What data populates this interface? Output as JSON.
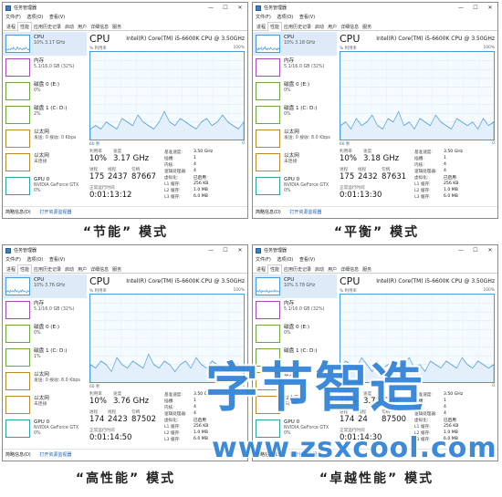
{
  "window": {
    "title": "任务管理器",
    "min": "—",
    "max": "☐",
    "close": "✕"
  },
  "menu": [
    "文件(F)",
    "选项(O)",
    "查看(V)"
  ],
  "tabs": [
    "进程",
    "性能",
    "应用历史记录",
    "启动",
    "用户",
    "详细信息",
    "服务"
  ],
  "sidebar": [
    {
      "name": "CPU",
      "sub": "",
      "kind": "cpu"
    },
    {
      "name": "内存",
      "sub": "5.1/16.0 GB (32%)",
      "kind": "mem"
    },
    {
      "name": "磁盘 0 (E:)",
      "sub": "0%",
      "kind": "disk"
    },
    {
      "name": "磁盘 1 (C: D:)",
      "sub": "",
      "kind": "disk"
    },
    {
      "name": "以太网",
      "sub": "",
      "kind": "net"
    },
    {
      "name": "以太网",
      "sub": "未连接",
      "kind": "net"
    },
    {
      "name": "GPU 0",
      "sub": "NVIDIA GeForce GTX",
      "sub2": "0%",
      "kind": "gpu"
    }
  ],
  "main": {
    "cpu_title": "CPU",
    "cpu_model": "Intel(R) Core(TM) i5-6600K CPU @ 3.50GHz",
    "util_label": "% 利用率",
    "util_max": "100%",
    "graph_left": "60 秒",
    "graph_right": "0",
    "labels": {
      "util": "利用率",
      "speed": "速度",
      "proc": "进程",
      "threads": "线程",
      "handles": "句柄",
      "uptime": "正常运行时间"
    },
    "spec_keys": [
      "基准速度:",
      "插槽:",
      "内核:",
      "逻辑处理器:",
      "虚拟化:",
      "L1 缓存:",
      "L2 缓存:",
      "L3 缓存:"
    ],
    "spec_vals": [
      "3.50 GHz",
      "1",
      "4",
      "4",
      "已启用",
      "256 KB",
      "1.0 MB",
      "6.0 MB"
    ]
  },
  "footer": {
    "brief": "简略信息(D)",
    "monitor": "打开资源监视器"
  },
  "panels": [
    {
      "cpu_sub": "10%  3.17 GHz",
      "disk1_sub": "2%",
      "net_sub": "发送: 0 接收: 0 Kbps",
      "util": "10%",
      "speed": "3.17 GHz",
      "proc": "175",
      "threads": "2437",
      "handles": "87667",
      "uptime": "0:01:13:12",
      "graph": [
        3,
        4,
        3,
        5,
        4,
        3,
        6,
        5,
        4,
        7,
        5,
        4,
        3,
        5,
        8,
        5,
        4,
        6,
        5,
        4,
        3,
        5,
        6,
        4,
        5,
        7,
        5,
        4,
        3,
        5
      ],
      "caption": "“节能”  模式"
    },
    {
      "cpu_sub": "10%  3.18 GHz",
      "disk1_sub": "0%",
      "net_sub": "发送: 0 接收: 8.0 Kbps",
      "util": "10%",
      "speed": "3.18 GHz",
      "proc": "175",
      "threads": "2432",
      "handles": "87631",
      "uptime": "0:01:13:30",
      "graph": [
        4,
        5,
        3,
        6,
        4,
        5,
        7,
        4,
        3,
        6,
        5,
        8,
        4,
        5,
        3,
        6,
        5,
        4,
        7,
        5,
        4,
        3,
        6,
        5,
        4,
        5,
        3,
        6,
        4,
        5
      ],
      "caption": "“平衡”  模式"
    },
    {
      "cpu_sub": "10%  3.76 GHz",
      "disk1_sub": "1%",
      "net_sub": "发送: 0 接收: 8.0 Kbps",
      "util": "10%",
      "speed": "3.76 GHz",
      "proc": "174",
      "threads": "2423",
      "handles": "87502",
      "uptime": "0:01:14:50",
      "graph": [
        5,
        4,
        6,
        5,
        3,
        7,
        5,
        4,
        6,
        5,
        4,
        8,
        5,
        4,
        6,
        5,
        3,
        5,
        6,
        4,
        7,
        5,
        4,
        6,
        5,
        4,
        3,
        6,
        5,
        4
      ],
      "caption": "“高性能”  模式"
    },
    {
      "cpu_sub": "10%  3.78 GHz",
      "disk1_sub": "",
      "net_sub": "",
      "util": "10%",
      "speed": "3.78 GHz",
      "proc": "174",
      "threads": "24",
      "handles": "87500",
      "uptime": "0:01:14:30",
      "graph": [
        4,
        6,
        5,
        4,
        7,
        5,
        3,
        6,
        4,
        5,
        6,
        4,
        5,
        7,
        4,
        5,
        3,
        6,
        5,
        4,
        6,
        5,
        4,
        7,
        5,
        4,
        6,
        5,
        4,
        5
      ],
      "caption": "“卓越性能”  模式"
    }
  ],
  "watermark": {
    "big": "字节智造",
    "url": "www.zsxcool.com"
  },
  "colors": {
    "cpu": "#4b9ad8",
    "graph_line": "#4b9ad8",
    "watermark": "#2f82d6"
  }
}
